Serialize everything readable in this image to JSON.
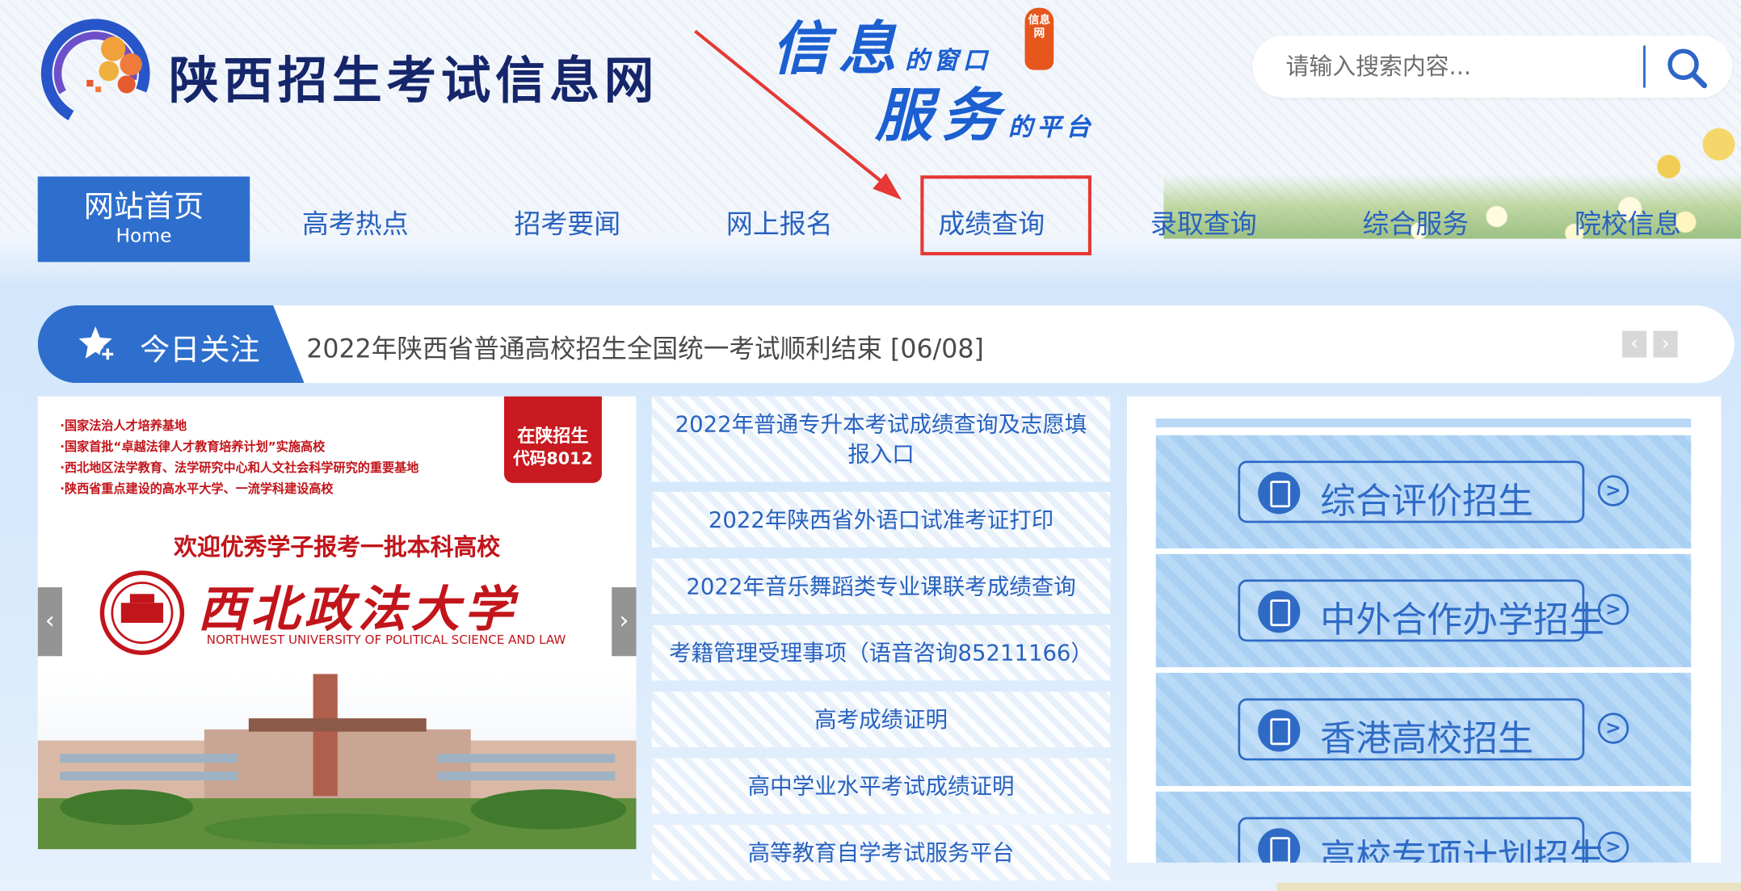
{
  "header": {
    "site_title": "陕西招生考试信息网",
    "slogan_line1_main": "信息",
    "slogan_line1_small": "的窗口",
    "slogan_line2_main": "服务",
    "slogan_line2_small": "的平台",
    "slogan_badge": "信息网"
  },
  "search": {
    "placeholder": "请输入搜索内容...",
    "icon": "search-icon"
  },
  "nav": {
    "home_label": "网站首页",
    "home_sub": "Home",
    "items": [
      "高考热点",
      "招考要闻",
      "网上报名",
      "成绩查询",
      "录取查询",
      "综合服务",
      "院校信息"
    ],
    "highlighted_item": "成绩查询",
    "highlight_color": "#e53935"
  },
  "focus": {
    "label": "今日关注",
    "icon": "star-plus-icon",
    "headline": "2022年陕西省普通高校招生全国统一考试顺利结束  [06/08]",
    "prev": "‹",
    "next": "›"
  },
  "banner": {
    "points": [
      "·国家法治人才培养基地",
      "·国家首批“卓越法律人才教育培养计划”实施高校",
      "·西北地区法学教育、法学研究中心和人文社会科学研究的重要基地",
      "·陕西省重点建设的高水平大学、一流学科建设高校"
    ],
    "tag_line1": "在陕招生",
    "tag_line2": "代码8012",
    "welcome": "欢迎优秀学子报考一批本科高校",
    "university_name": "西北政法大学",
    "university_name_en": "NORTHWEST UNIVERSITY OF POLITICAL SCIENCE AND LAW",
    "prev": "‹",
    "next": "›"
  },
  "links": [
    "2022年普通专升本考试成绩查询及志愿填报入口",
    "2022年陕西省外语口试准考证打印",
    "2022年音乐舞蹈类专业课联考成绩查询",
    "考籍管理受理事项（语音咨询85211166）",
    "高考成绩证明",
    "高中学业水平考试成绩证明",
    "高等教育自学考试服务平台"
  ],
  "tiles": [
    "综合评价招生",
    "中外合作办学招生",
    "香港高校招生",
    "高校专项计划招生"
  ],
  "colors": {
    "brand_blue": "#2e6fce",
    "nav_text": "#2862bf",
    "title_navy": "#16266b",
    "banner_red": "#c2151b"
  }
}
